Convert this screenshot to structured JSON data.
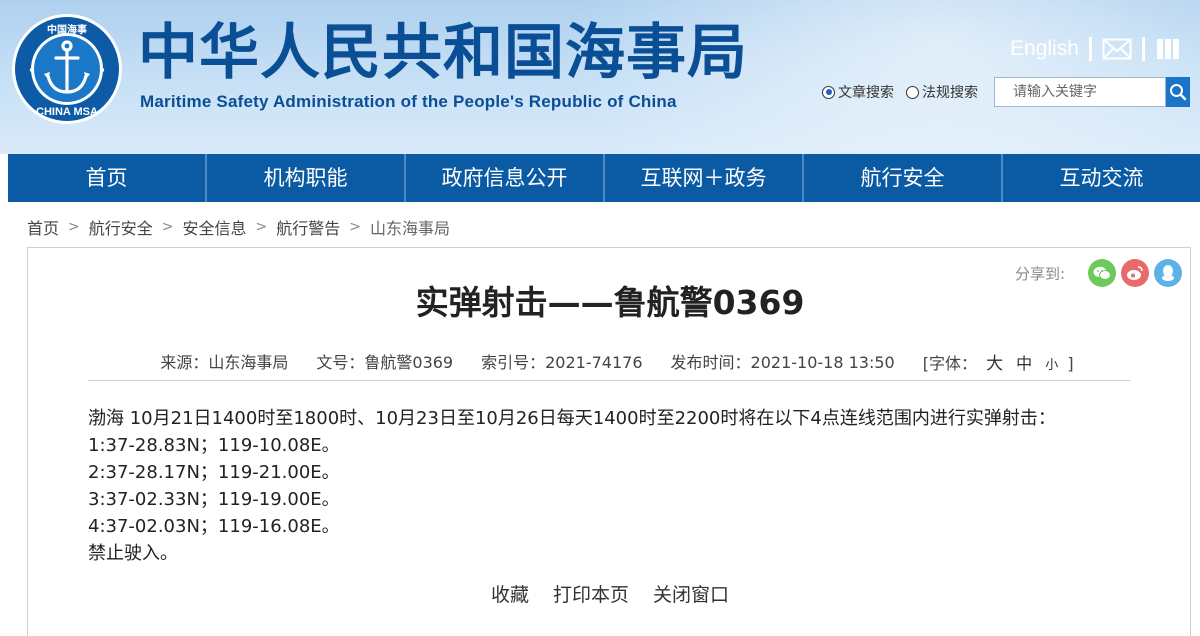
{
  "header": {
    "logo_text": "CHINA MSA",
    "logo_top_text": "中国海事",
    "title": "中华人民共和国海事局",
    "subtitle": "Maritime Safety Administration of the People's Republic of China",
    "english_link": "English",
    "icons": [
      "mail-icon",
      "book-icon"
    ]
  },
  "search": {
    "options": [
      {
        "label": "文章搜索",
        "selected": true
      },
      {
        "label": "法规搜索",
        "selected": false
      }
    ],
    "placeholder": "请输入关键字"
  },
  "nav": {
    "items": [
      "首页",
      "机构职能",
      "政府信息公开",
      "互联网＋政务",
      "航行安全",
      "互动交流"
    ]
  },
  "breadcrumb": [
    "首页",
    "航行安全",
    "安全信息",
    "航行警告",
    "山东海事局"
  ],
  "article": {
    "share_label": "分享到:",
    "share_icons": [
      "wechat-icon",
      "weibo-icon",
      "qq-icon"
    ],
    "title": "实弹射击——鲁航警0369",
    "meta": {
      "source": "来源：山东海事局",
      "doc_no": "文号：鲁航警0369",
      "index_no": "索引号：2021-74176",
      "publish_time": "发布时间：2021-10-18 13:50",
      "font_label": "[字体：",
      "font_large": "大",
      "font_medium": "中",
      "font_small": "小",
      "font_close": "]"
    },
    "paragraphs": [
      "渤海 10月21日1400时至1800时、10月23日至10月26日每天1400时至2200时将在以下4点连线范围内进行实弹射击：",
      "1:37-28.83N；119-10.08E。",
      "2:37-28.17N；119-21.00E。",
      "3:37-02.33N；119-19.00E。",
      "4:37-02.03N；119-16.08E。",
      "禁止驶入。"
    ],
    "actions": [
      "收藏",
      "打印本页",
      "关闭窗口"
    ]
  },
  "colors": {
    "brand_blue": "#0a4f96",
    "nav_blue": "#0b5aa4",
    "wechat": "#6dc95b",
    "weibo": "#e86b6b",
    "qq": "#5eb0e8"
  }
}
